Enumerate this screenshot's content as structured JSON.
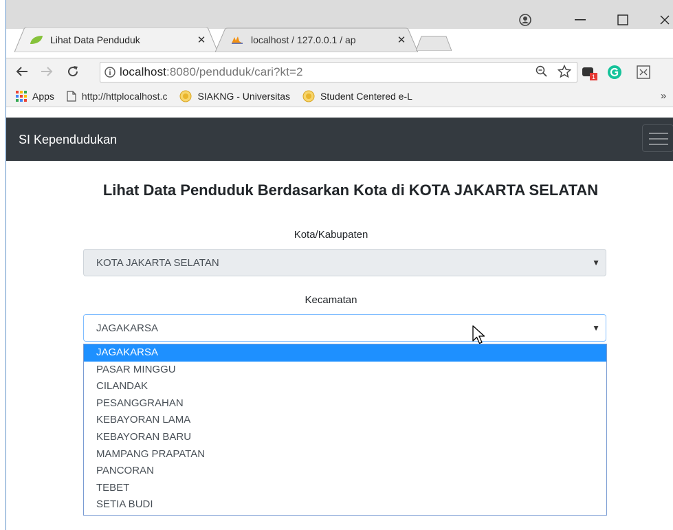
{
  "browser": {
    "tabs": [
      {
        "title": "Lihat Data Penduduk",
        "close": "✕"
      },
      {
        "title": "localhost / 127.0.0.1 / ap",
        "close": "✕"
      }
    ],
    "url_host": "localhost",
    "url_path": ":8080/penduduk/cari?kt=2",
    "extension_badge": "1",
    "bookmarks": [
      {
        "label": "Apps",
        "icon": "apps-grid-icon"
      },
      {
        "label": "http://httplocalhost.c",
        "icon": "page-icon"
      },
      {
        "label": "SIAKNG - Universitas",
        "icon": "university-seal-icon"
      },
      {
        "label": "Student Centered e-L",
        "icon": "university-seal-icon"
      }
    ],
    "bookmarks_overflow": "»"
  },
  "navbar": {
    "brand": "SI Kependudukan"
  },
  "page": {
    "heading": "Lihat Data Penduduk Berdasarkan Kota di KOTA JAKARTA SELATAN",
    "kota_label": "Kota/Kabupaten",
    "kota_value": "KOTA JAKARTA SELATAN",
    "kecamatan_label": "Kecamatan",
    "kecamatan_value": "JAGAKARSA",
    "kecamatan_options": [
      "JAGAKARSA",
      "PASAR MINGGU",
      "CILANDAK",
      "PESANGGRAHAN",
      "KEBAYORAN LAMA",
      "KEBAYORAN BARU",
      "MAMPANG PRAPATAN",
      "PANCORAN",
      "TEBET",
      "SETIA BUDI"
    ],
    "selected_index": 0
  },
  "colors": {
    "navbar_bg": "#343a40",
    "option_highlight": "#1e90ff",
    "focus_border": "#80bdff"
  }
}
